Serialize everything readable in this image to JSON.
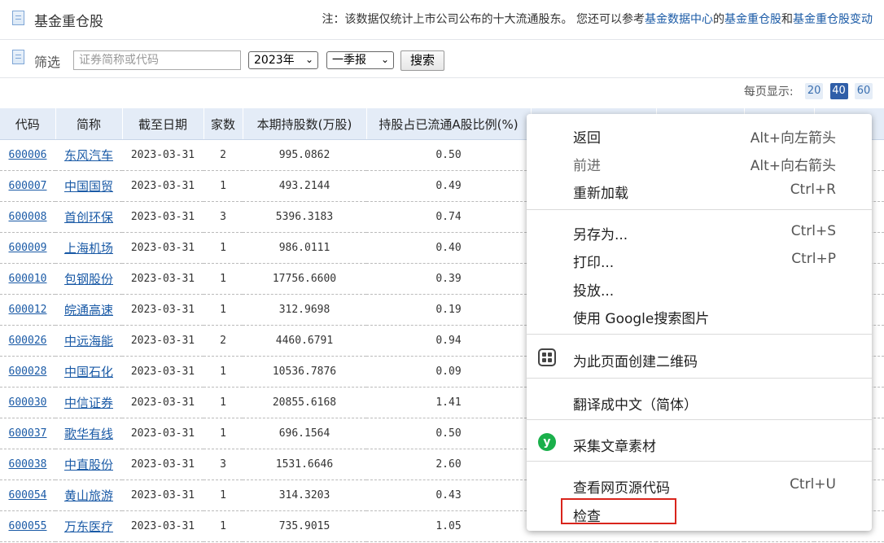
{
  "header": {
    "title": "基金重仓股",
    "notice_prefix": "注：该数据仅统计上市公司公布的十大流通股东。 您还可以参考",
    "link1": "基金数据中心",
    "notice_mid1": "的",
    "link2": "基金重仓股",
    "notice_mid2": "和",
    "link3": "基金重仓股变动"
  },
  "filter": {
    "label": "筛选",
    "search_placeholder": "证券简称或代码",
    "year": "2023年",
    "period": "一季报",
    "search_button": "搜索"
  },
  "pager": {
    "label": "每页显示:",
    "sizes": [
      "20",
      "40",
      "60"
    ],
    "active": "40"
  },
  "table": {
    "headers": [
      "代码",
      "简称",
      "截至日期",
      "家数",
      "本期持股数(万股)",
      "持股占已流通A股比例(%)"
    ],
    "rows": [
      {
        "code": "600006",
        "name": "东风汽车",
        "date": "2023-03-31",
        "count": "2",
        "shares": "995.0862",
        "ratio": "0.50"
      },
      {
        "code": "600007",
        "name": "中国国贸",
        "date": "2023-03-31",
        "count": "1",
        "shares": "493.2144",
        "ratio": "0.49"
      },
      {
        "code": "600008",
        "name": "首创环保",
        "date": "2023-03-31",
        "count": "3",
        "shares": "5396.3183",
        "ratio": "0.74"
      },
      {
        "code": "600009",
        "name": "上海机场",
        "date": "2023-03-31",
        "count": "1",
        "shares": "986.0111",
        "ratio": "0.40"
      },
      {
        "code": "600010",
        "name": "包钢股份",
        "date": "2023-03-31",
        "count": "1",
        "shares": "17756.6600",
        "ratio": "0.39"
      },
      {
        "code": "600012",
        "name": "皖通高速",
        "date": "2023-03-31",
        "count": "1",
        "shares": "312.9698",
        "ratio": "0.19"
      },
      {
        "code": "600026",
        "name": "中远海能",
        "date": "2023-03-31",
        "count": "2",
        "shares": "4460.6791",
        "ratio": "0.94"
      },
      {
        "code": "600028",
        "name": "中国石化",
        "date": "2023-03-31",
        "count": "1",
        "shares": "10536.7876",
        "ratio": "0.09"
      },
      {
        "code": "600030",
        "name": "中信证券",
        "date": "2023-03-31",
        "count": "1",
        "shares": "20855.6168",
        "ratio": "1.41"
      },
      {
        "code": "600037",
        "name": "歌华有线",
        "date": "2023-03-31",
        "count": "1",
        "shares": "696.1564",
        "ratio": "0.50"
      },
      {
        "code": "600038",
        "name": "中直股份",
        "date": "2023-03-31",
        "count": "3",
        "shares": "1531.6646",
        "ratio": "2.60"
      },
      {
        "code": "600054",
        "name": "黄山旅游",
        "date": "2023-03-31",
        "count": "1",
        "shares": "314.3203",
        "ratio": "0.43"
      },
      {
        "code": "600055",
        "name": "万东医疗",
        "date": "2023-03-31",
        "count": "1",
        "shares": "735.9015",
        "ratio": "1.05"
      }
    ]
  },
  "context_menu": {
    "back": {
      "label": "返回",
      "shortcut": "Alt+向左箭头"
    },
    "forward": {
      "label": "前进",
      "shortcut": "Alt+向右箭头"
    },
    "reload": {
      "label": "重新加载",
      "shortcut": "Ctrl+R"
    },
    "save_as": {
      "label": "另存为...",
      "shortcut": "Ctrl+S"
    },
    "print": {
      "label": "打印...",
      "shortcut": "Ctrl+P"
    },
    "cast": {
      "label": "投放..."
    },
    "google_image": {
      "label": "使用 Google搜索图片"
    },
    "qr_code": {
      "label": "为此页面创建二维码"
    },
    "translate": {
      "label": "翻译成中文（简体）"
    },
    "collect": {
      "label": "采集文章素材"
    },
    "view_source": {
      "label": "查看网页源代码",
      "shortcut": "Ctrl+U"
    },
    "inspect": {
      "label": "检查"
    }
  },
  "colors": {
    "link": "#1a5aa6",
    "header_bg": "#e4ecf7",
    "highlight": "#d9241c",
    "green_icon": "#1ab04b"
  }
}
